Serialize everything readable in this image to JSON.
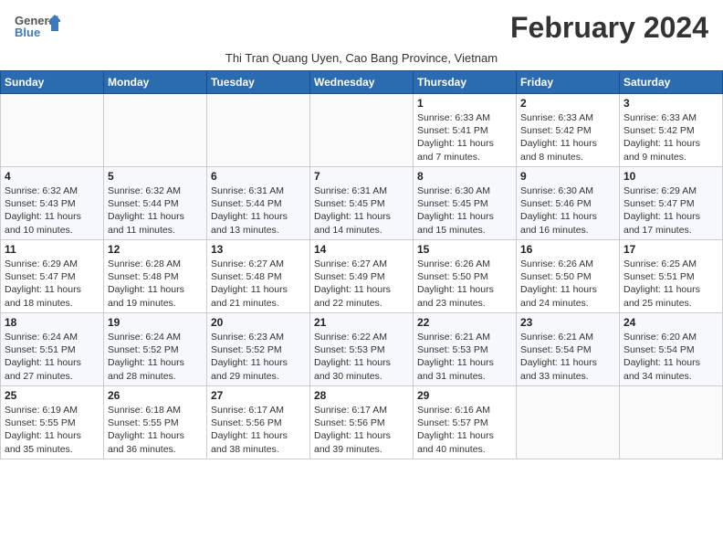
{
  "logo": {
    "line1": "General",
    "line2": "Blue"
  },
  "title": "February 2024",
  "subtitle": "Thi Tran Quang Uyen, Cao Bang Province, Vietnam",
  "days_of_week": [
    "Sunday",
    "Monday",
    "Tuesday",
    "Wednesday",
    "Thursday",
    "Friday",
    "Saturday"
  ],
  "weeks": [
    [
      {
        "day": "",
        "info": ""
      },
      {
        "day": "",
        "info": ""
      },
      {
        "day": "",
        "info": ""
      },
      {
        "day": "",
        "info": ""
      },
      {
        "day": "1",
        "info": "Sunrise: 6:33 AM\nSunset: 5:41 PM\nDaylight: 11 hours and 7 minutes."
      },
      {
        "day": "2",
        "info": "Sunrise: 6:33 AM\nSunset: 5:42 PM\nDaylight: 11 hours and 8 minutes."
      },
      {
        "day": "3",
        "info": "Sunrise: 6:33 AM\nSunset: 5:42 PM\nDaylight: 11 hours and 9 minutes."
      }
    ],
    [
      {
        "day": "4",
        "info": "Sunrise: 6:32 AM\nSunset: 5:43 PM\nDaylight: 11 hours and 10 minutes."
      },
      {
        "day": "5",
        "info": "Sunrise: 6:32 AM\nSunset: 5:44 PM\nDaylight: 11 hours and 11 minutes."
      },
      {
        "day": "6",
        "info": "Sunrise: 6:31 AM\nSunset: 5:44 PM\nDaylight: 11 hours and 13 minutes."
      },
      {
        "day": "7",
        "info": "Sunrise: 6:31 AM\nSunset: 5:45 PM\nDaylight: 11 hours and 14 minutes."
      },
      {
        "day": "8",
        "info": "Sunrise: 6:30 AM\nSunset: 5:45 PM\nDaylight: 11 hours and 15 minutes."
      },
      {
        "day": "9",
        "info": "Sunrise: 6:30 AM\nSunset: 5:46 PM\nDaylight: 11 hours and 16 minutes."
      },
      {
        "day": "10",
        "info": "Sunrise: 6:29 AM\nSunset: 5:47 PM\nDaylight: 11 hours and 17 minutes."
      }
    ],
    [
      {
        "day": "11",
        "info": "Sunrise: 6:29 AM\nSunset: 5:47 PM\nDaylight: 11 hours and 18 minutes."
      },
      {
        "day": "12",
        "info": "Sunrise: 6:28 AM\nSunset: 5:48 PM\nDaylight: 11 hours and 19 minutes."
      },
      {
        "day": "13",
        "info": "Sunrise: 6:27 AM\nSunset: 5:48 PM\nDaylight: 11 hours and 21 minutes."
      },
      {
        "day": "14",
        "info": "Sunrise: 6:27 AM\nSunset: 5:49 PM\nDaylight: 11 hours and 22 minutes."
      },
      {
        "day": "15",
        "info": "Sunrise: 6:26 AM\nSunset: 5:50 PM\nDaylight: 11 hours and 23 minutes."
      },
      {
        "day": "16",
        "info": "Sunrise: 6:26 AM\nSunset: 5:50 PM\nDaylight: 11 hours and 24 minutes."
      },
      {
        "day": "17",
        "info": "Sunrise: 6:25 AM\nSunset: 5:51 PM\nDaylight: 11 hours and 25 minutes."
      }
    ],
    [
      {
        "day": "18",
        "info": "Sunrise: 6:24 AM\nSunset: 5:51 PM\nDaylight: 11 hours and 27 minutes."
      },
      {
        "day": "19",
        "info": "Sunrise: 6:24 AM\nSunset: 5:52 PM\nDaylight: 11 hours and 28 minutes."
      },
      {
        "day": "20",
        "info": "Sunrise: 6:23 AM\nSunset: 5:52 PM\nDaylight: 11 hours and 29 minutes."
      },
      {
        "day": "21",
        "info": "Sunrise: 6:22 AM\nSunset: 5:53 PM\nDaylight: 11 hours and 30 minutes."
      },
      {
        "day": "22",
        "info": "Sunrise: 6:21 AM\nSunset: 5:53 PM\nDaylight: 11 hours and 31 minutes."
      },
      {
        "day": "23",
        "info": "Sunrise: 6:21 AM\nSunset: 5:54 PM\nDaylight: 11 hours and 33 minutes."
      },
      {
        "day": "24",
        "info": "Sunrise: 6:20 AM\nSunset: 5:54 PM\nDaylight: 11 hours and 34 minutes."
      }
    ],
    [
      {
        "day": "25",
        "info": "Sunrise: 6:19 AM\nSunset: 5:55 PM\nDaylight: 11 hours and 35 minutes."
      },
      {
        "day": "26",
        "info": "Sunrise: 6:18 AM\nSunset: 5:55 PM\nDaylight: 11 hours and 36 minutes."
      },
      {
        "day": "27",
        "info": "Sunrise: 6:17 AM\nSunset: 5:56 PM\nDaylight: 11 hours and 38 minutes."
      },
      {
        "day": "28",
        "info": "Sunrise: 6:17 AM\nSunset: 5:56 PM\nDaylight: 11 hours and 39 minutes."
      },
      {
        "day": "29",
        "info": "Sunrise: 6:16 AM\nSunset: 5:57 PM\nDaylight: 11 hours and 40 minutes."
      },
      {
        "day": "",
        "info": ""
      },
      {
        "day": "",
        "info": ""
      }
    ]
  ]
}
